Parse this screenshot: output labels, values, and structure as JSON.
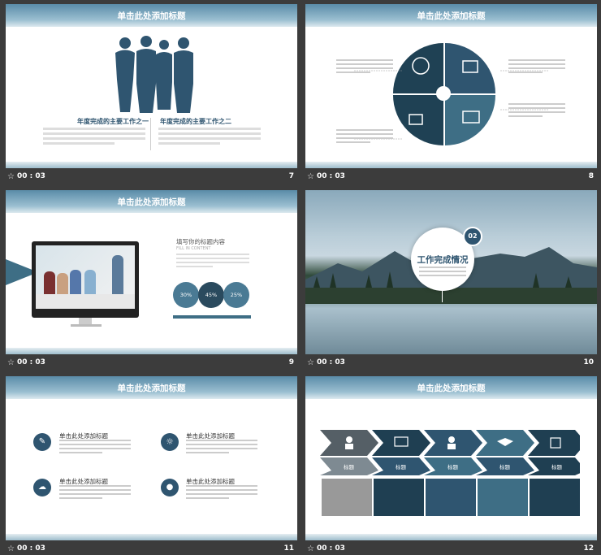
{
  "slides": [
    {
      "title": "单击此处添加标题",
      "time": "00 : 03",
      "num": "7",
      "left_heading": "年度完成的主要工作之一",
      "right_heading": "年度完成的主要工作之二"
    },
    {
      "title": "单击此处添加标题",
      "time": "00 : 03",
      "num": "8"
    },
    {
      "title": "单击此处添加标题",
      "time": "00 : 03",
      "num": "9",
      "heading": "填写你的标题内容",
      "subheading": "FILL IN CONTENT",
      "circles": [
        "30%",
        "45%",
        "25%"
      ]
    },
    {
      "time": "00 : 03",
      "num": "10",
      "badge": "02",
      "heading": "工作完成情况"
    },
    {
      "title": "单击此处添加标题",
      "time": "00 : 03",
      "num": "11",
      "items": [
        "单击此处添加标题",
        "单击此处添加标题",
        "单击此处添加标题",
        "单击此处添加标题"
      ]
    },
    {
      "title": "单击此处添加标题",
      "time": "00 : 03",
      "num": "12",
      "labels": [
        "标题",
        "标题",
        "标题",
        "标题",
        "标题"
      ]
    }
  ],
  "colors": {
    "accent": "#2f5570",
    "teal": "#3e6e85",
    "header": "#6a97ae",
    "bg": "#3c3c3c"
  }
}
